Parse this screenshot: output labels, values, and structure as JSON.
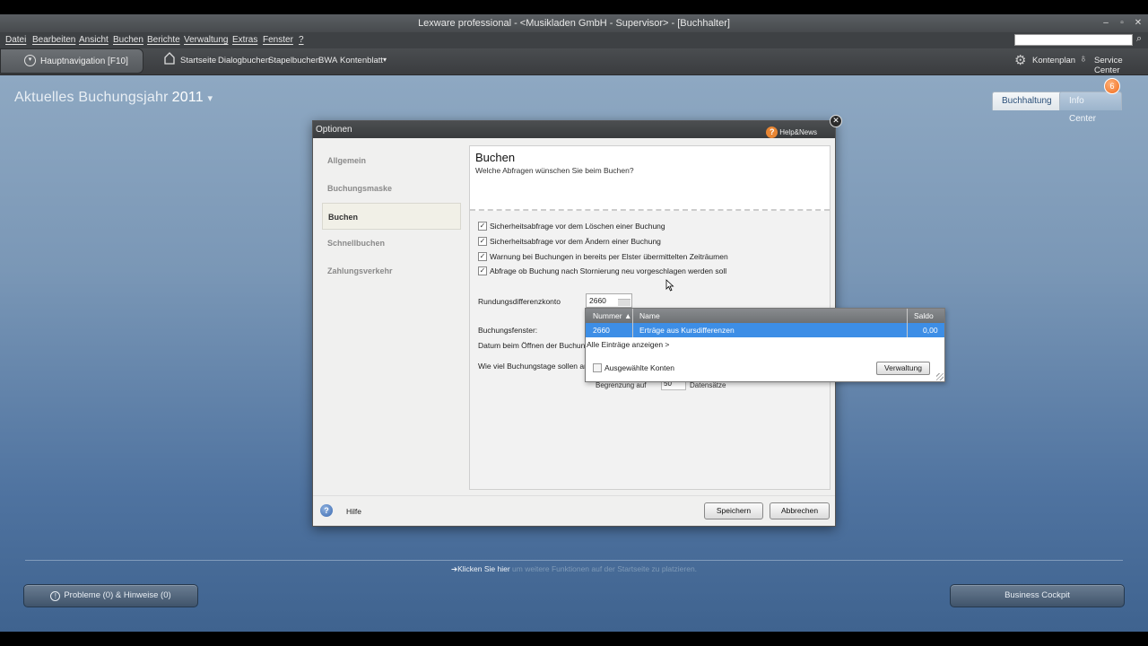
{
  "window": {
    "title": "Lexware professional - <Musikladen GmbH - Supervisor> - [Buchhalter]",
    "controls": [
      "–",
      "▫",
      "✕"
    ]
  },
  "menu": [
    "Datei",
    "Bearbeiten",
    "Ansicht",
    "Buchen",
    "Berichte",
    "Verwaltung",
    "Extras",
    "Fenster",
    "?"
  ],
  "toolbar": {
    "hauptnav_label": "Hauptnavigation [F10]",
    "links": [
      "Startseite",
      "Dialogbuchen",
      "Stapelbuchen",
      "BWA",
      "Kontenblatt"
    ],
    "kontenplan": "Kontenplan",
    "service_center": "Service Center"
  },
  "header": {
    "jahr_label": "Aktuelles Buchungsjahr",
    "jahr_value": "2011",
    "tabs": [
      "Buchhaltung",
      "Info Center"
    ],
    "badge": "6"
  },
  "dialog": {
    "title": "Optionen",
    "help_news": "Help&News",
    "nav": [
      "Allgemein",
      "Buchungsmaske",
      "Buchen",
      "Schnellbuchen",
      "Zahlungsverkehr"
    ],
    "active_nav": "Buchen",
    "panel_title": "Buchen",
    "panel_subtitle": "Welche Abfragen wünschen Sie beim Buchen?",
    "checkboxes": [
      {
        "label": "Sicherheitsabfrage vor dem Löschen einer Buchung",
        "checked": true
      },
      {
        "label": "Sicherheitsabfrage vor dem Ändern einer Buchung",
        "checked": true
      },
      {
        "label": "Warnung bei Buchungen in bereits per Elster übermittelten Zeiträumen",
        "checked": true
      },
      {
        "label": "Abfrage ob Buchung nach Stornierung neu vorgeschlagen werden soll",
        "checked": true
      }
    ],
    "rundungs_label": "Rundungsdifferenzkonto",
    "rundungs_value": "2660",
    "buchungsfenster_label": "Buchungsfenster:",
    "datum_label": "Datum beim Öffnen der Buchun",
    "buchungstage_label": "Wie viel Buchungstage sollen an",
    "begrenzung_label": "Begrenzung auf",
    "begrenzung_value": "50",
    "datensaetze_label": "Datensätze",
    "hilfe": "Hilfe",
    "save": "Speichern",
    "cancel": "Abbrechen"
  },
  "dropdown": {
    "headers": [
      "Nummer ▲",
      "Name",
      "Saldo"
    ],
    "row": {
      "nummer": "2660",
      "name": "Erträge aus Kursdifferenzen",
      "saldo": "0,00"
    },
    "all_entries": "Alle Einträge anzeigen >",
    "selected_accounts": "Ausgewählte Konten",
    "verwaltung": "Verwaltung"
  },
  "footer": {
    "klick_link": "Klicken Sie hier",
    "klick_rest": " um weitere Funktionen auf der Startseite zu platzieren.",
    "probleme": "Probleme (0) & Hinweise (0)",
    "cockpit": "Business Cockpit"
  }
}
